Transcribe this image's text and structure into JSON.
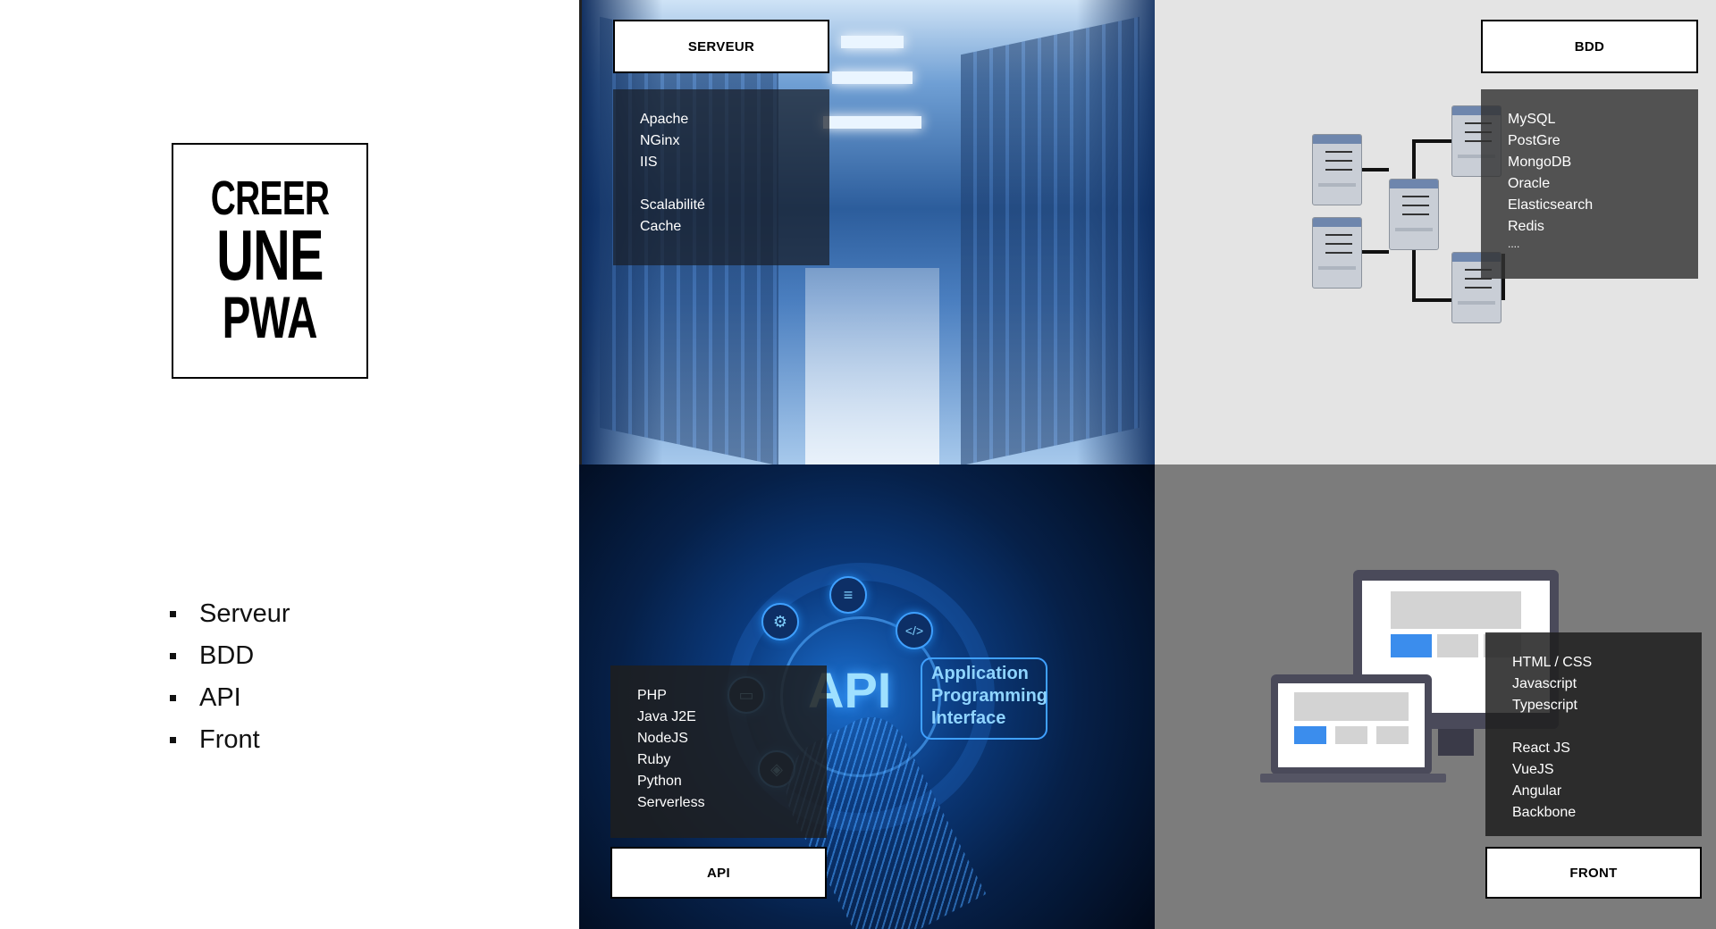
{
  "title": {
    "line1": "CREER",
    "line2": "UNE",
    "line3": "PWA"
  },
  "toc": [
    "Serveur",
    "BDD",
    "API",
    "Front"
  ],
  "serveur": {
    "label": "SERVEUR",
    "items": [
      "Apache",
      "NGinx",
      "IIS"
    ],
    "extras": [
      "Scalabilité",
      "Cache"
    ]
  },
  "bdd": {
    "label": "BDD",
    "items": [
      "MySQL",
      "PostGre",
      "MongoDB",
      "Oracle",
      "Elasticsearch",
      "Redis",
      "...."
    ]
  },
  "api": {
    "label": "API",
    "items": [
      "PHP",
      "Java J2E",
      "NodeJS",
      "Ruby",
      "Python",
      "Serverless"
    ],
    "image_text": "API",
    "image_caption": [
      "Application",
      "Programming",
      "Interface"
    ]
  },
  "front": {
    "label": "FRONT",
    "items": [
      "HTML / CSS",
      "Javascript",
      "Typescript"
    ],
    "frameworks": [
      "React JS",
      "VueJS",
      "Angular",
      "Backbone"
    ]
  },
  "colors": {
    "panel_dark": "#1e1e1e",
    "bdd_bg": "#e4e4e4",
    "front_bg": "#7c7c7c",
    "accent_blue": "#3b8ded"
  },
  "icons": [
    "gear-icon",
    "database-icon",
    "code-icon",
    "laptop-icon",
    "shield-icon"
  ]
}
